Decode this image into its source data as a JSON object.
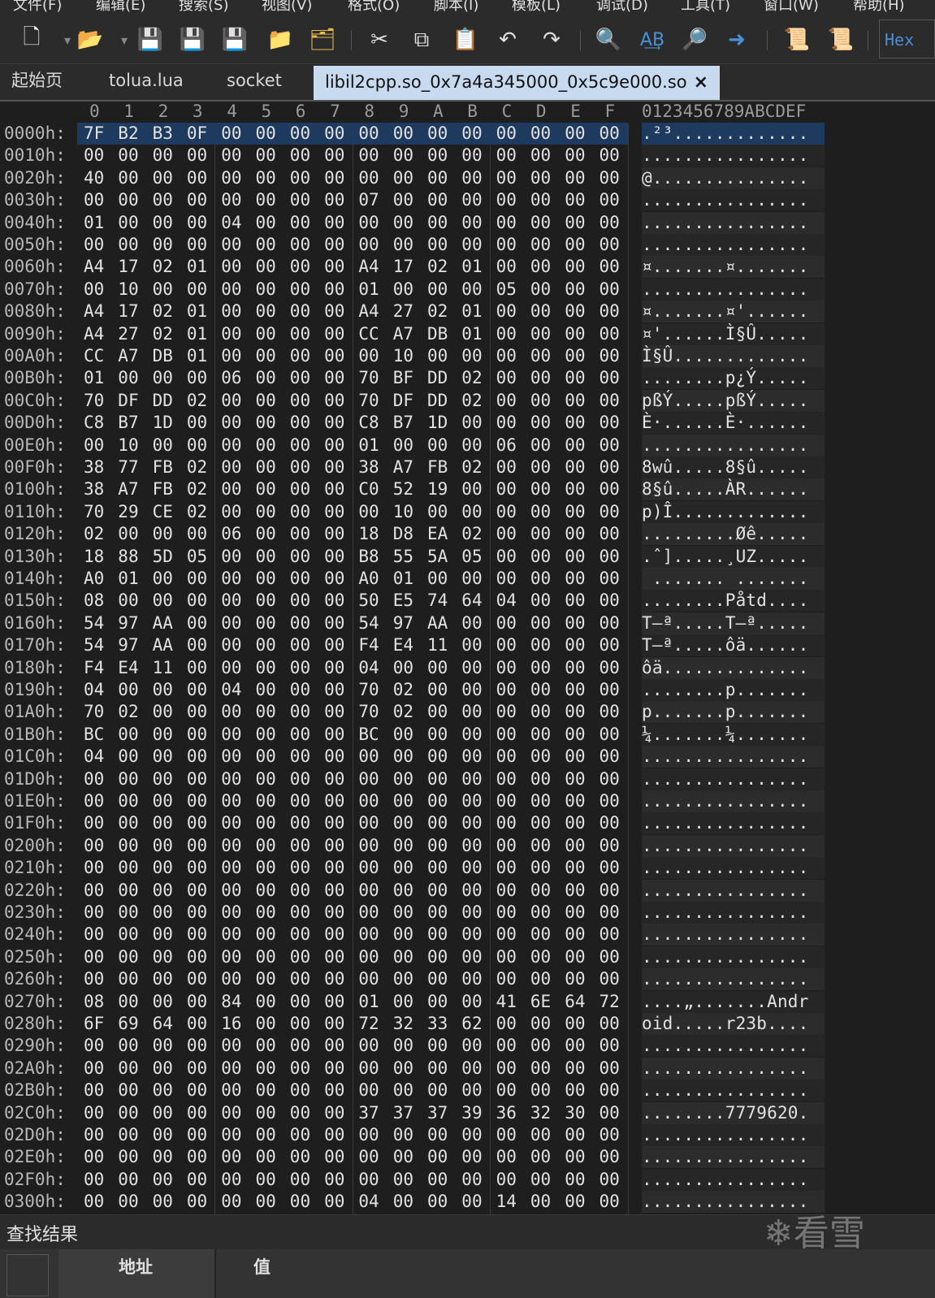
{
  "menu": [
    "文件(F)",
    "编辑(E)",
    "搜索(S)",
    "视图(V)",
    "格式(O)",
    "脚本(I)",
    "模板(L)",
    "调试(D)",
    "工具(T)",
    "窗口(W)",
    "帮助(H)"
  ],
  "toolbar": {
    "hex_label": "Hex"
  },
  "tabs": [
    {
      "label": "起始页"
    },
    {
      "label": "tolua.lua"
    },
    {
      "label": "socket"
    },
    {
      "label": "libil2cpp.so_0x7a4a345000_0x5c9e000.so",
      "active": true,
      "close": "×"
    }
  ],
  "hex": {
    "column_headers": [
      "0",
      "1",
      "2",
      "3",
      "4",
      "5",
      "6",
      "7",
      "8",
      "9",
      "A",
      "B",
      "C",
      "D",
      "E",
      "F"
    ],
    "ascii_header": "0123456789ABCDEF",
    "rows": [
      {
        "addr": "0000h:",
        "bytes": "7F B2 B3 0F 00 00 00 00 00 00 00 00 00 00 00 00",
        "ascii": ".²³............."
      },
      {
        "addr": "0010h:",
        "bytes": "00 00 00 00 00 00 00 00 00 00 00 00 00 00 00 00",
        "ascii": "................"
      },
      {
        "addr": "0020h:",
        "bytes": "40 00 00 00 00 00 00 00 00 00 00 00 00 00 00 00",
        "ascii": "@..............."
      },
      {
        "addr": "0030h:",
        "bytes": "00 00 00 00 00 00 00 00 07 00 00 00 00 00 00 00",
        "ascii": "................"
      },
      {
        "addr": "0040h:",
        "bytes": "01 00 00 00 04 00 00 00 00 00 00 00 00 00 00 00",
        "ascii": "................"
      },
      {
        "addr": "0050h:",
        "bytes": "00 00 00 00 00 00 00 00 00 00 00 00 00 00 00 00",
        "ascii": "................"
      },
      {
        "addr": "0060h:",
        "bytes": "A4 17 02 01 00 00 00 00 A4 17 02 01 00 00 00 00",
        "ascii": "¤.......¤......."
      },
      {
        "addr": "0070h:",
        "bytes": "00 10 00 00 00 00 00 00 01 00 00 00 05 00 00 00",
        "ascii": "................"
      },
      {
        "addr": "0080h:",
        "bytes": "A4 17 02 01 00 00 00 00 A4 27 02 01 00 00 00 00",
        "ascii": "¤.......¤'......"
      },
      {
        "addr": "0090h:",
        "bytes": "A4 27 02 01 00 00 00 00 CC A7 DB 01 00 00 00 00",
        "ascii": "¤'......Ì§Û....."
      },
      {
        "addr": "00A0h:",
        "bytes": "CC A7 DB 01 00 00 00 00 00 10 00 00 00 00 00 00",
        "ascii": "Ì§Û............."
      },
      {
        "addr": "00B0h:",
        "bytes": "01 00 00 00 06 00 00 00 70 BF DD 02 00 00 00 00",
        "ascii": "........p¿Ý....."
      },
      {
        "addr": "00C0h:",
        "bytes": "70 DF DD 02 00 00 00 00 70 DF DD 02 00 00 00 00",
        "ascii": "pßÝ.....pßÝ....."
      },
      {
        "addr": "00D0h:",
        "bytes": "C8 B7 1D 00 00 00 00 00 C8 B7 1D 00 00 00 00 00",
        "ascii": "È·......È·......"
      },
      {
        "addr": "00E0h:",
        "bytes": "00 10 00 00 00 00 00 00 01 00 00 00 06 00 00 00",
        "ascii": "................"
      },
      {
        "addr": "00F0h:",
        "bytes": "38 77 FB 02 00 00 00 00 38 A7 FB 02 00 00 00 00",
        "ascii": "8wû.....8§û....."
      },
      {
        "addr": "0100h:",
        "bytes": "38 A7 FB 02 00 00 00 00 C0 52 19 00 00 00 00 00",
        "ascii": "8§û.....ÀR......"
      },
      {
        "addr": "0110h:",
        "bytes": "70 29 CE 02 00 00 00 00 00 10 00 00 00 00 00 00",
        "ascii": "p)Î............."
      },
      {
        "addr": "0120h:",
        "bytes": "02 00 00 00 06 00 00 00 18 D8 EA 02 00 00 00 00",
        "ascii": ".........Øê....."
      },
      {
        "addr": "0130h:",
        "bytes": "18 88 5D 05 00 00 00 00 B8 55 5A 05 00 00 00 00",
        "ascii": ".ˆ].....¸UZ....."
      },
      {
        "addr": "0140h:",
        "bytes": "A0 01 00 00 00 00 00 00 A0 01 00 00 00 00 00 00",
        "ascii": " ....... ......."
      },
      {
        "addr": "0150h:",
        "bytes": "08 00 00 00 00 00 00 00 50 E5 74 64 04 00 00 00",
        "ascii": "........Påtd...."
      },
      {
        "addr": "0160h:",
        "bytes": "54 97 AA 00 00 00 00 00 54 97 AA 00 00 00 00 00",
        "ascii": "T—ª.....T—ª....."
      },
      {
        "addr": "0170h:",
        "bytes": "54 97 AA 00 00 00 00 00 F4 E4 11 00 00 00 00 00",
        "ascii": "T—ª.....ôä......"
      },
      {
        "addr": "0180h:",
        "bytes": "F4 E4 11 00 00 00 00 00 04 00 00 00 00 00 00 00",
        "ascii": "ôä.............."
      },
      {
        "addr": "0190h:",
        "bytes": "04 00 00 00 04 00 00 00 70 02 00 00 00 00 00 00",
        "ascii": "........p......."
      },
      {
        "addr": "01A0h:",
        "bytes": "70 02 00 00 00 00 00 00 70 02 00 00 00 00 00 00",
        "ascii": "p.......p......."
      },
      {
        "addr": "01B0h:",
        "bytes": "BC 00 00 00 00 00 00 00 BC 00 00 00 00 00 00 00",
        "ascii": "¼.......¼......."
      },
      {
        "addr": "01C0h:",
        "bytes": "04 00 00 00 00 00 00 00 00 00 00 00 00 00 00 00",
        "ascii": "................"
      },
      {
        "addr": "01D0h:",
        "bytes": "00 00 00 00 00 00 00 00 00 00 00 00 00 00 00 00",
        "ascii": "................"
      },
      {
        "addr": "01E0h:",
        "bytes": "00 00 00 00 00 00 00 00 00 00 00 00 00 00 00 00",
        "ascii": "................"
      },
      {
        "addr": "01F0h:",
        "bytes": "00 00 00 00 00 00 00 00 00 00 00 00 00 00 00 00",
        "ascii": "................"
      },
      {
        "addr": "0200h:",
        "bytes": "00 00 00 00 00 00 00 00 00 00 00 00 00 00 00 00",
        "ascii": "................"
      },
      {
        "addr": "0210h:",
        "bytes": "00 00 00 00 00 00 00 00 00 00 00 00 00 00 00 00",
        "ascii": "................"
      },
      {
        "addr": "0220h:",
        "bytes": "00 00 00 00 00 00 00 00 00 00 00 00 00 00 00 00",
        "ascii": "................"
      },
      {
        "addr": "0230h:",
        "bytes": "00 00 00 00 00 00 00 00 00 00 00 00 00 00 00 00",
        "ascii": "................"
      },
      {
        "addr": "0240h:",
        "bytes": "00 00 00 00 00 00 00 00 00 00 00 00 00 00 00 00",
        "ascii": "................"
      },
      {
        "addr": "0250h:",
        "bytes": "00 00 00 00 00 00 00 00 00 00 00 00 00 00 00 00",
        "ascii": "................"
      },
      {
        "addr": "0260h:",
        "bytes": "00 00 00 00 00 00 00 00 00 00 00 00 00 00 00 00",
        "ascii": "................"
      },
      {
        "addr": "0270h:",
        "bytes": "08 00 00 00 84 00 00 00 01 00 00 00 41 6E 64 72",
        "ascii": "....„.......Andr"
      },
      {
        "addr": "0280h:",
        "bytes": "6F 69 64 00 16 00 00 00 72 32 33 62 00 00 00 00",
        "ascii": "oid.....r23b...."
      },
      {
        "addr": "0290h:",
        "bytes": "00 00 00 00 00 00 00 00 00 00 00 00 00 00 00 00",
        "ascii": "................"
      },
      {
        "addr": "02A0h:",
        "bytes": "00 00 00 00 00 00 00 00 00 00 00 00 00 00 00 00",
        "ascii": "................"
      },
      {
        "addr": "02B0h:",
        "bytes": "00 00 00 00 00 00 00 00 00 00 00 00 00 00 00 00",
        "ascii": "................"
      },
      {
        "addr": "02C0h:",
        "bytes": "00 00 00 00 00 00 00 00 37 37 37 39 36 32 30 00",
        "ascii": "........7779620."
      },
      {
        "addr": "02D0h:",
        "bytes": "00 00 00 00 00 00 00 00 00 00 00 00 00 00 00 00",
        "ascii": "................"
      },
      {
        "addr": "02E0h:",
        "bytes": "00 00 00 00 00 00 00 00 00 00 00 00 00 00 00 00",
        "ascii": "................"
      },
      {
        "addr": "02F0h:",
        "bytes": "00 00 00 00 00 00 00 00 00 00 00 00 00 00 00 00",
        "ascii": "................"
      },
      {
        "addr": "0300h:",
        "bytes": "00 00 00 00 00 00 00 00 04 00 00 00 14 00 00 00",
        "ascii": "................"
      }
    ]
  },
  "find_results": {
    "title": "查找结果",
    "columns": [
      "地址",
      "值"
    ]
  },
  "watermark": "❄看雪"
}
